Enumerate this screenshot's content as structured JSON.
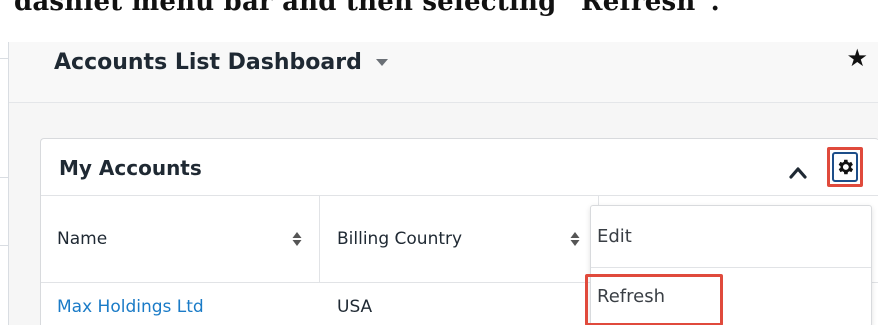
{
  "caption": {
    "text": "dashlet menu bar and then selecting “Refresh”."
  },
  "dashboard": {
    "title": "Accounts List Dashboard",
    "dropdown_icon": "caret-down-icon",
    "favorite_icon": "star-icon",
    "favorite_glyph": "★"
  },
  "dashlet": {
    "title": "My Accounts",
    "collapse_icon": "chevron-up-icon",
    "settings_icon": "gear-icon",
    "columns": [
      {
        "label": "Name",
        "sort_icon": "sort-icon"
      },
      {
        "label": "Billing Country",
        "sort_icon": "sort-icon"
      }
    ],
    "rows": [
      {
        "name": "Max Holdings Ltd",
        "billing_country": "USA"
      }
    ]
  },
  "menu": {
    "items": [
      {
        "label": "Edit"
      },
      {
        "label": "Refresh"
      }
    ]
  },
  "colors": {
    "highlight": "#e04a3c",
    "link": "#1a7bc7",
    "focus_border": "#1d4e89"
  }
}
